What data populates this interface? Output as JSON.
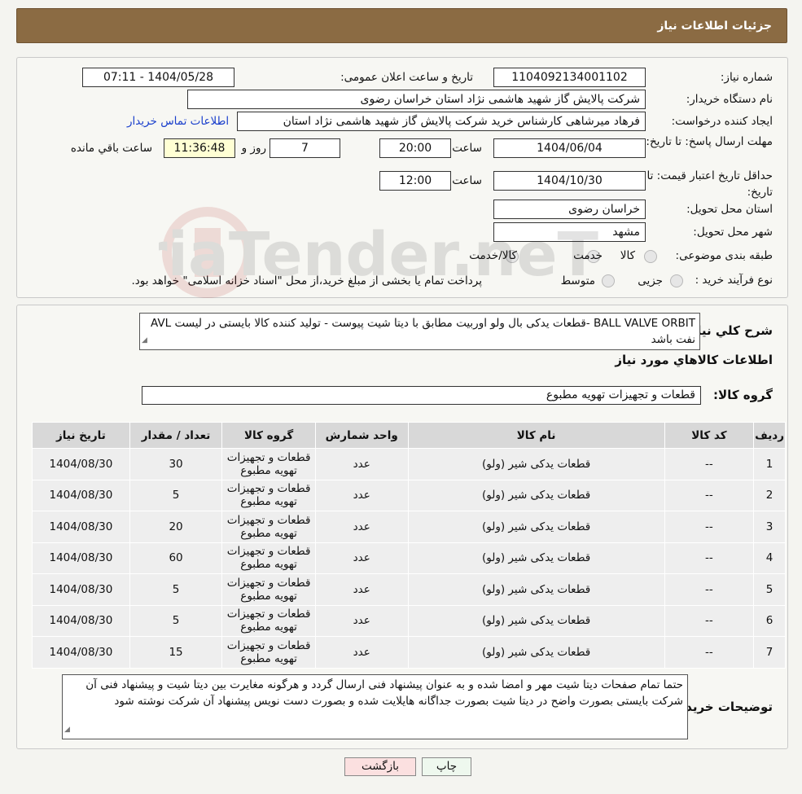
{
  "header": {
    "title": "جزئیات اطلاعات نیاز"
  },
  "fields": {
    "need_number_label": "شماره نیاز:",
    "need_number": "1104092134001102",
    "announce_label": "تاریخ و ساعت اعلان عمومی:",
    "announce_value": "1404/05/28 - 07:11",
    "buyer_label": "نام دستگاه خریدار:",
    "buyer_value": "شرکت پالایش گاز شهید هاشمی نژاد   استان خراسان رضوی",
    "creator_label": "ایجاد کننده درخواست:",
    "creator_value": "فرهاد میرشاهی کارشناس خرید شرکت پالایش گاز شهید هاشمی نژاد   استان",
    "contact_link": "اطلاعات تماس خریدار",
    "deadline_label": "مهلت ارسال پاسخ: تا تاریخ:",
    "deadline_date": "1404/06/04",
    "time_label": "ساعت",
    "deadline_time": "20:00",
    "deadline_days": "7",
    "days_label": "روز و",
    "remaining_time": "11:36:48",
    "remaining_label": "ساعت باقي مانده",
    "validity_label": "حداقل تاریخ اعتبار قیمت: تا تاریخ:",
    "validity_date": "1404/10/30",
    "validity_time": "12:00",
    "province_label": "استان محل تحویل:",
    "province_value": "خراسان رضوی",
    "city_label": "شهر محل تحویل:",
    "city_value": "مشهد",
    "category_label": "طبقه بندی موضوعی:",
    "cat_opt1": "کالا",
    "cat_opt2": "خدمت",
    "cat_opt3": "کالا/خدمت",
    "process_label": "نوع فرآیند خرید :",
    "proc_opt1": "جزیی",
    "proc_opt2": "متوسط",
    "proc_note": "پرداخت تمام یا بخشی از مبلغ خرید،از محل \"اسناد خزانه اسلامی\" خواهد بود."
  },
  "watermark": {
    "text": "AriaTender.neT"
  },
  "summary": {
    "label": "شرح كلي نياز:",
    "text": "BALL VALVE ORBIT -قطعات یدکی بال ولو اوربیت مطابق با دیتا شیت پیوست - تولید کننده کالا بایستی در لیست AVL نفت باشد",
    "goods_info_title": "اطلاعات كالاهاي مورد نياز",
    "group_label": "گروه کالا:",
    "group_value": "قطعات و تجهیزات تهویه مطبوع"
  },
  "table": {
    "headers": [
      "ردیف",
      "کد کالا",
      "نام کالا",
      "واحد شمارش",
      "گروه کالا",
      "تعداد / مقدار",
      "تاریخ نیاز"
    ],
    "rows": [
      [
        "1",
        "--",
        "قطعات یدکی شیر (ولو)",
        "عدد",
        "قطعات و تجهیزات تهویه مطبوع",
        "30",
        "1404/08/30"
      ],
      [
        "2",
        "--",
        "قطعات یدکی شیر (ولو)",
        "عدد",
        "قطعات و تجهیزات تهویه مطبوع",
        "5",
        "1404/08/30"
      ],
      [
        "3",
        "--",
        "قطعات یدکی شیر (ولو)",
        "عدد",
        "قطعات و تجهیزات تهویه مطبوع",
        "20",
        "1404/08/30"
      ],
      [
        "4",
        "--",
        "قطعات یدکی شیر (ولو)",
        "عدد",
        "قطعات و تجهیزات تهویه مطبوع",
        "60",
        "1404/08/30"
      ],
      [
        "5",
        "--",
        "قطعات یدکی شیر (ولو)",
        "عدد",
        "قطعات و تجهیزات تهویه مطبوع",
        "5",
        "1404/08/30"
      ],
      [
        "6",
        "--",
        "قطعات یدکی شیر (ولو)",
        "عدد",
        "قطعات و تجهیزات تهویه مطبوع",
        "5",
        "1404/08/30"
      ],
      [
        "7",
        "--",
        "قطعات یدکی شیر (ولو)",
        "عدد",
        "قطعات و تجهیزات تهویه مطبوع",
        "15",
        "1404/08/30"
      ]
    ]
  },
  "buyer_notes": {
    "label": "توضیحات خریدار:",
    "text": "حتما تمام صفحات دیتا شیت مهر و امضا شده و به عنوان پیشنهاد فنی ارسال گردد و هرگونه مغایرت بین دیتا شیت و پیشنهاد فنی آن شرکت بایستی بصورت واضح در دیتا شیت بصورت جداگانه هایلایت شده و بصورت دست نویس پیشنهاد آن شرکت نوشته شود"
  },
  "buttons": {
    "print": "چاپ",
    "back": "بازگشت"
  },
  "colors": {
    "header_bg": "#8b6b43",
    "link": "#1a3fcc",
    "back_button_bg": "#fbe0e0"
  }
}
